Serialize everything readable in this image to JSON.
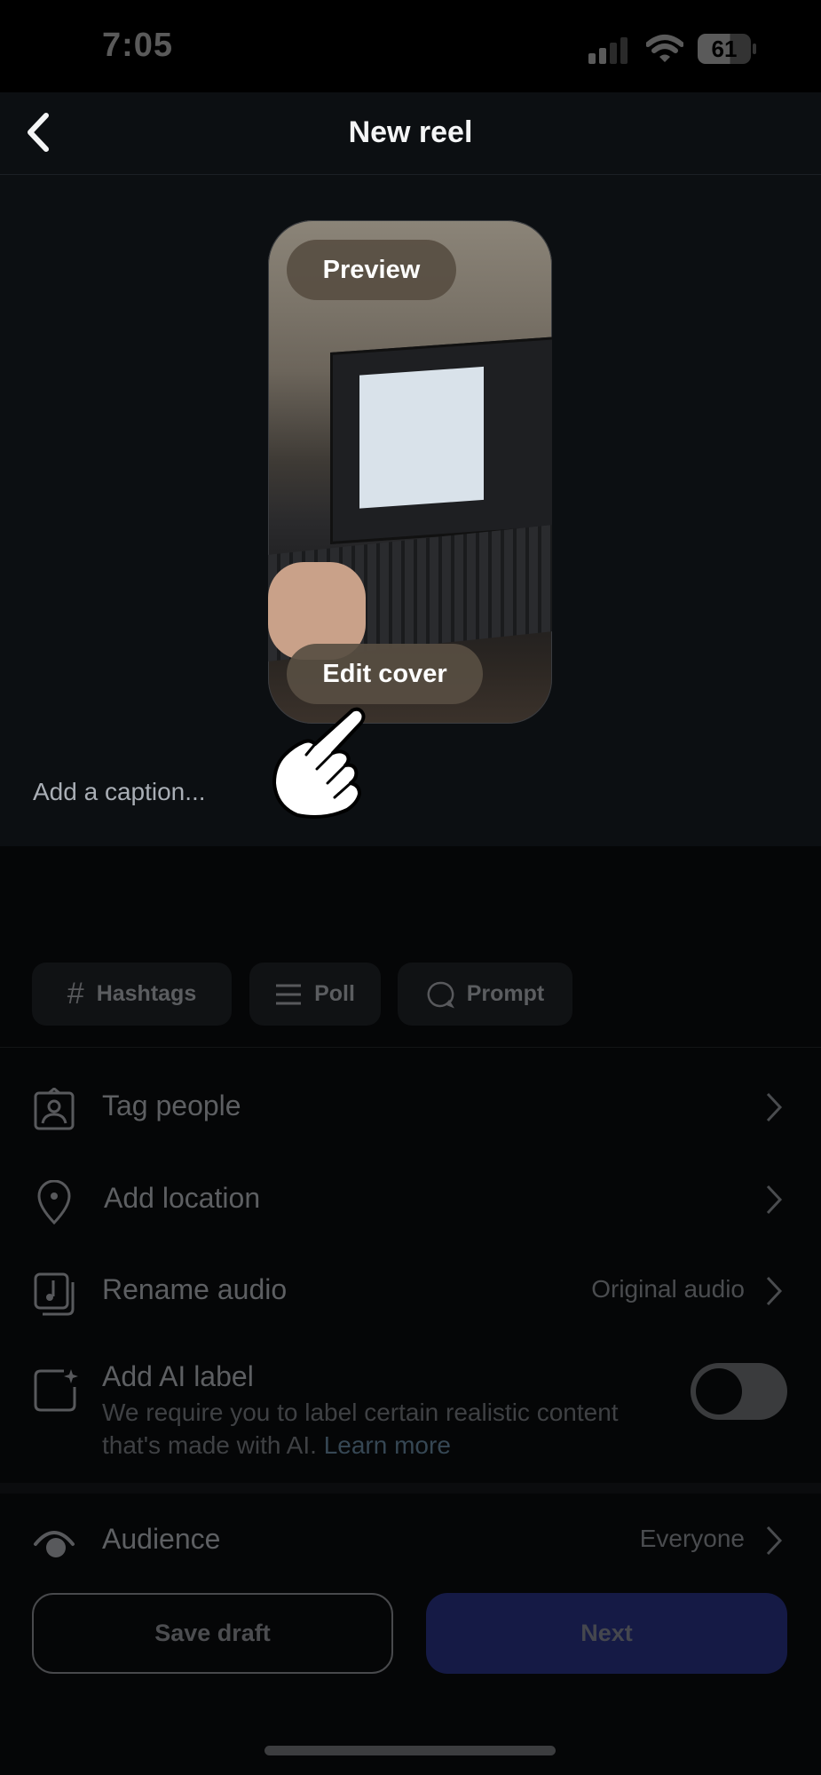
{
  "status_bar": {
    "time": "7:05",
    "battery": "61",
    "icons": [
      "signal-icon",
      "wifi-icon",
      "battery-icon"
    ]
  },
  "header": {
    "title": "New reel",
    "back_icon": "chevron-left-icon"
  },
  "preview": {
    "preview_label": "Preview",
    "edit_cover_label": "Edit cover"
  },
  "caption": {
    "placeholder": "Add a caption..."
  },
  "chips": [
    {
      "icon": "hashtag-icon",
      "label": "Hashtags"
    },
    {
      "icon": "poll-icon",
      "label": "Poll"
    },
    {
      "icon": "prompt-icon",
      "label": "Prompt"
    }
  ],
  "rows": {
    "tag_people": {
      "label": "Tag people"
    },
    "add_location": {
      "label": "Add location"
    },
    "rename_audio": {
      "label": "Rename audio",
      "value": "Original audio"
    },
    "ai_label": {
      "title": "Add AI label",
      "description": "We require you to label certain realistic content that's made with AI.",
      "link": "Learn more",
      "toggle_on": false
    },
    "audience": {
      "label": "Audience",
      "value": "Everyone"
    }
  },
  "footer": {
    "save_draft": "Save draft",
    "next": "Next"
  },
  "colors": {
    "next_button": "#151a45",
    "background": "#050607",
    "top_section": "#0c0f12"
  }
}
